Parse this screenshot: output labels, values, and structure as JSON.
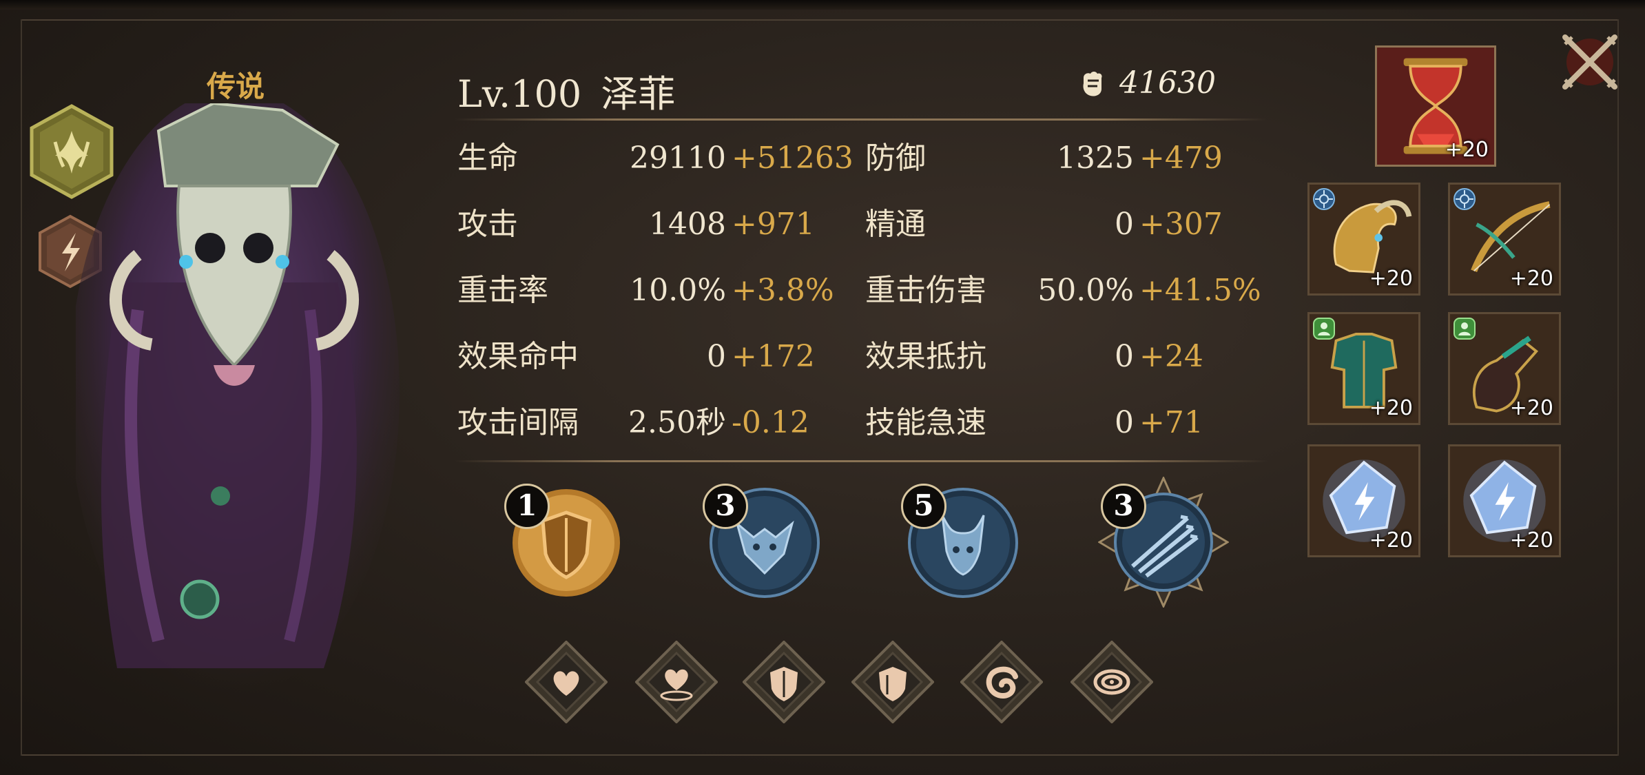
{
  "hero": {
    "rarity": "传说",
    "level": "Lv.100",
    "name": "泽菲",
    "power": "41630"
  },
  "stats": [
    {
      "label": "生命",
      "base": "29110",
      "bonus": "+51263"
    },
    {
      "label": "防御",
      "base": "1325",
      "bonus": "+479"
    },
    {
      "label": "攻击",
      "base": "1408",
      "bonus": "+971"
    },
    {
      "label": "精通",
      "base": "0",
      "bonus": "+307"
    },
    {
      "label": "重击率",
      "base": "10.0%",
      "bonus": "+3.8%"
    },
    {
      "label": "重击伤害",
      "base": "50.0%",
      "bonus": "+41.5%"
    },
    {
      "label": "效果命中",
      "base": "0",
      "bonus": "+172"
    },
    {
      "label": "效果抵抗",
      "base": "0",
      "bonus": "+24"
    },
    {
      "label": "攻击间隔",
      "base": "2.50秒",
      "bonus": "-0.12"
    },
    {
      "label": "技能急速",
      "base": "0",
      "bonus": "+71"
    }
  ],
  "skills": [
    {
      "level": "1",
      "icon": "shield-skill-icon"
    },
    {
      "level": "3",
      "icon": "dragon-skill-icon"
    },
    {
      "level": "5",
      "icon": "beast-skill-icon"
    },
    {
      "level": "3",
      "icon": "arrows-skill-icon"
    }
  ],
  "runes": [
    "heart-rune-icon",
    "heart-aura-rune-icon",
    "shield-rune-icon",
    "shield-rune-icon",
    "swirl-rune-icon",
    "spiral-rune-icon"
  ],
  "equipment": {
    "artifact": {
      "level": "+20",
      "icon": "hourglass-icon"
    },
    "slots": [
      {
        "level": "+20",
        "icon": "helmet-icon",
        "tag": "target-badge-icon"
      },
      {
        "level": "+20",
        "icon": "bow-icon",
        "tag": "target-badge-icon"
      },
      {
        "level": "+20",
        "icon": "armor-icon",
        "tag": "person-badge-icon"
      },
      {
        "level": "+20",
        "icon": "gauntlet-icon",
        "tag": "person-badge-icon"
      },
      {
        "level": "+20",
        "icon": "crystal-icon",
        "tag": ""
      },
      {
        "level": "+20",
        "icon": "crystal-icon",
        "tag": ""
      }
    ]
  },
  "colors": {
    "gold": "#d9a94a",
    "text": "#efe3c9",
    "panel": "#2a231d"
  }
}
